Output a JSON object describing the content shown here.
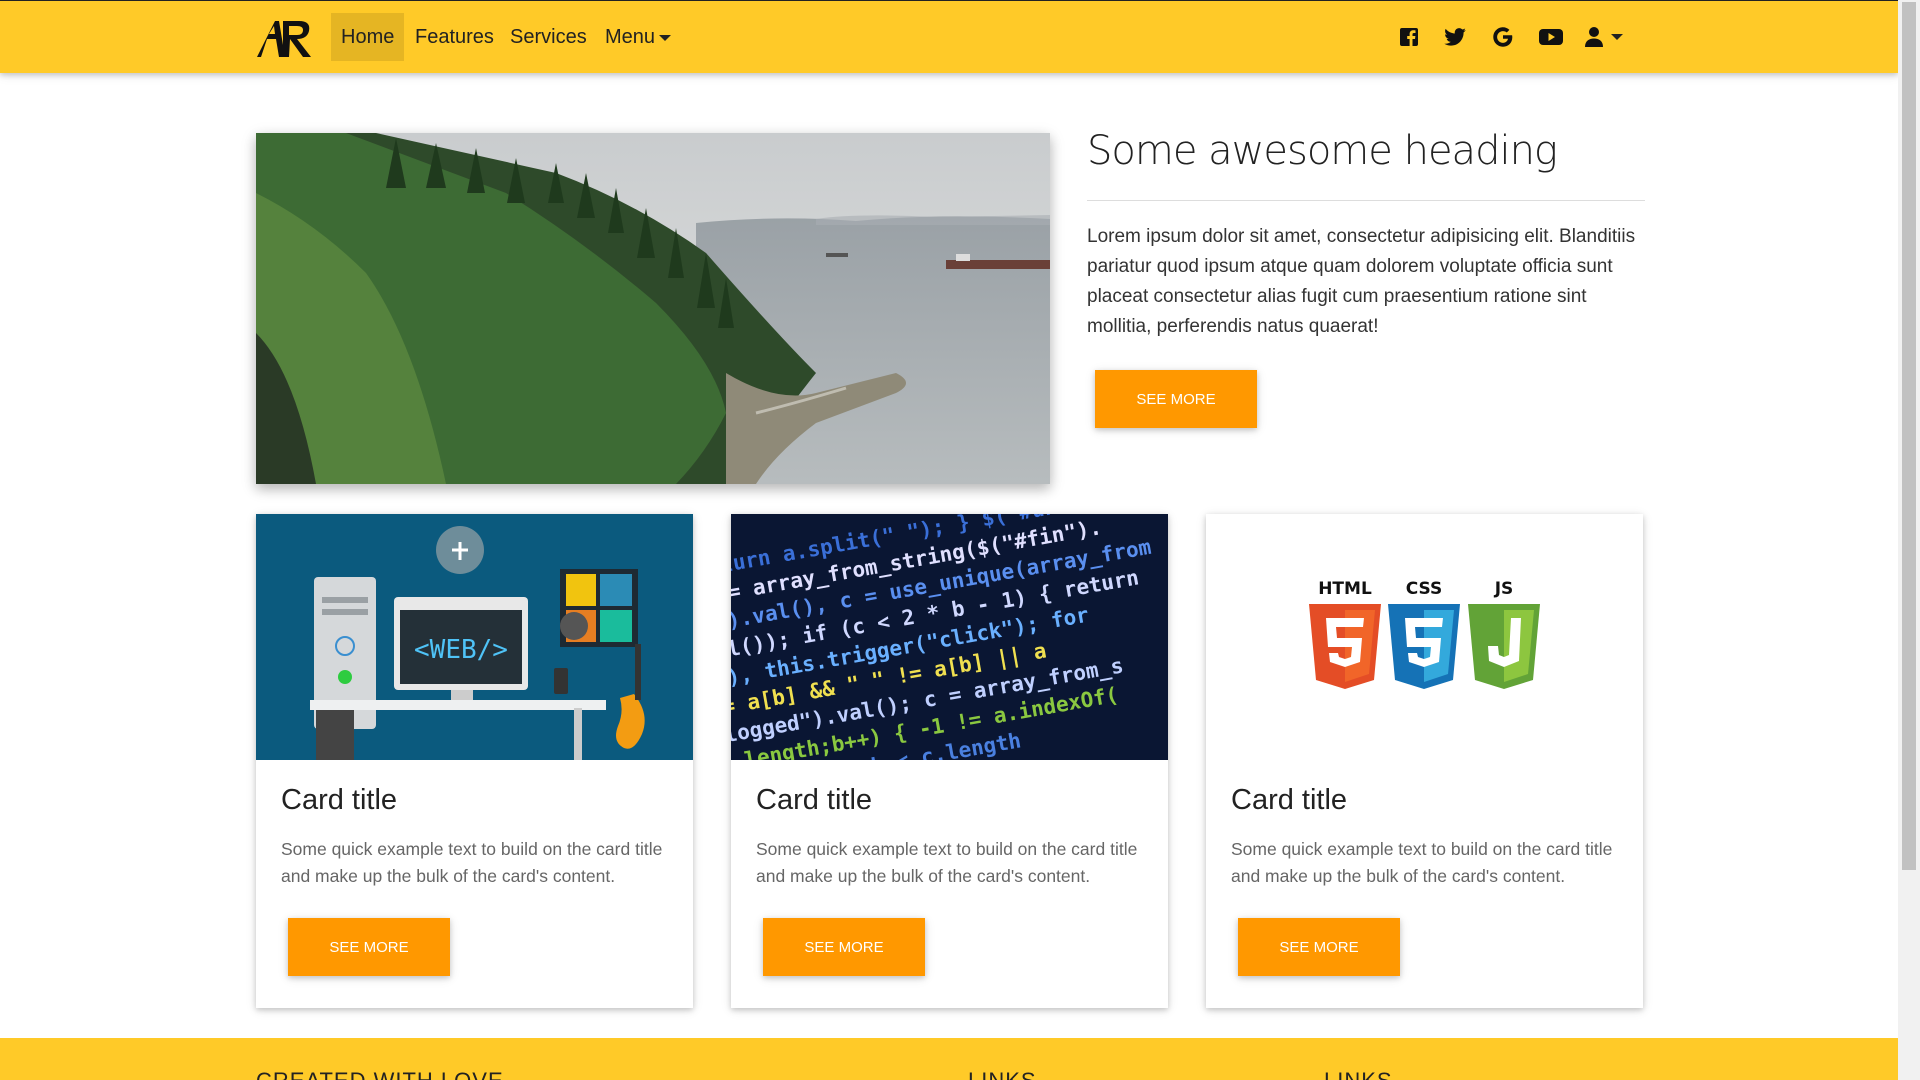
{
  "navbar": {
    "brand": "AR",
    "items": [
      {
        "label": "Home",
        "active": true
      },
      {
        "label": "Features"
      },
      {
        "label": "Services"
      },
      {
        "label": "Menu",
        "dropdown": true
      }
    ],
    "social_icons": [
      "facebook-icon",
      "twitter-icon",
      "google-icon",
      "youtube-icon",
      "user-icon"
    ],
    "bg_color": "#ffca28"
  },
  "hero": {
    "heading": "Some awesome heading",
    "text": "Lorem ipsum dolor sit amet, consectetur adipisicing elit. Blanditiis pariatur quod ipsum atque quam dolorem voluptate officia sunt placeat consectetur alias fugit cum praesentium ratione sint mollitia, perferendis natus quaerat!",
    "button_label": "SEE MORE"
  },
  "cards": [
    {
      "title": "Card title",
      "text": "Some quick example text to build on the card title and make up the bulk of the card's content.",
      "button_label": "SEE MORE",
      "image_text": "<WEB/>"
    },
    {
      "title": "Card title",
      "text": "Some quick example text to build on the card title and make up the bulk of the card's content.",
      "button_label": "SEE MORE"
    },
    {
      "title": "Card title",
      "text": "Some quick example text to build on the card title and make up the bulk of the card's content.",
      "button_label": "SEE MORE",
      "image_labels": [
        "HTML",
        "CSS",
        "JS"
      ]
    }
  ],
  "footer": {
    "headings": [
      "CREATED WITH LOVE",
      "LINKS",
      "LINKS"
    ]
  },
  "colors": {
    "accent": "#ff9800",
    "brand": "#ffca28"
  }
}
